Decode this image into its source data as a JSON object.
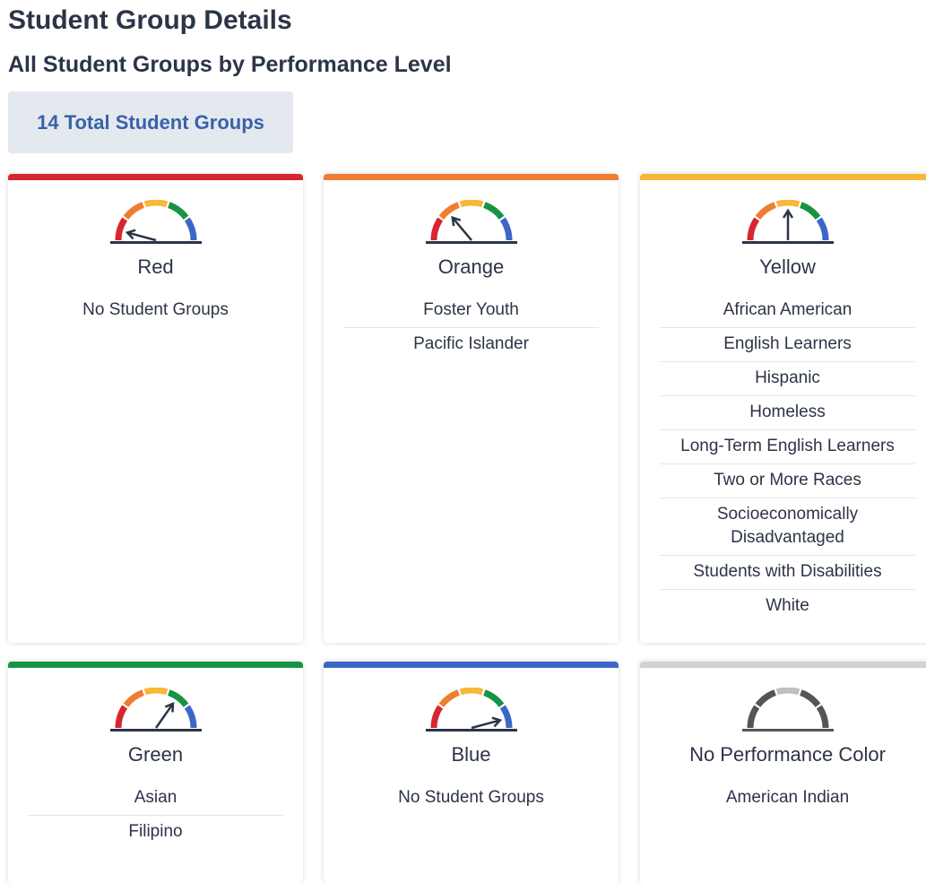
{
  "header": {
    "title": "Student Group Details",
    "subtitle": "All Student Groups by Performance Level",
    "total_badge": "14 Total Student Groups"
  },
  "gauge_colors": {
    "red": "#d7262f",
    "orange": "#f07d30",
    "yellow": "#f8b738",
    "green": "#179442",
    "blue": "#3c66c7",
    "gray_dark": "#555555",
    "gray_light": "#bfbfbf",
    "needle": "#2c3447"
  },
  "levels": [
    {
      "name": "Red",
      "color": "#d7262f",
      "gauge_icon": "gauge-red-icon",
      "groups": [
        "No Student Groups"
      ]
    },
    {
      "name": "Orange",
      "color": "#f07d30",
      "gauge_icon": "gauge-orange-icon",
      "groups": [
        "Foster Youth",
        "Pacific Islander"
      ]
    },
    {
      "name": "Yellow",
      "color": "#f8b738",
      "gauge_icon": "gauge-yellow-icon",
      "groups": [
        "African American",
        "English Learners",
        "Hispanic",
        "Homeless",
        "Long-Term English Learners",
        "Two or More Races",
        "Socioeconomically Disadvantaged",
        "Students with Disabilities",
        "White"
      ]
    },
    {
      "name": "Green",
      "color": "#179442",
      "gauge_icon": "gauge-green-icon",
      "groups": [
        "Asian",
        "Filipino"
      ]
    },
    {
      "name": "Blue",
      "color": "#3c66c7",
      "gauge_icon": "gauge-blue-icon",
      "groups": [
        "No Student Groups"
      ]
    },
    {
      "name": "No Performance Color",
      "color": "#d2d2d2",
      "gauge_icon": "gauge-gray-icon",
      "groups": [
        "American Indian"
      ]
    }
  ]
}
